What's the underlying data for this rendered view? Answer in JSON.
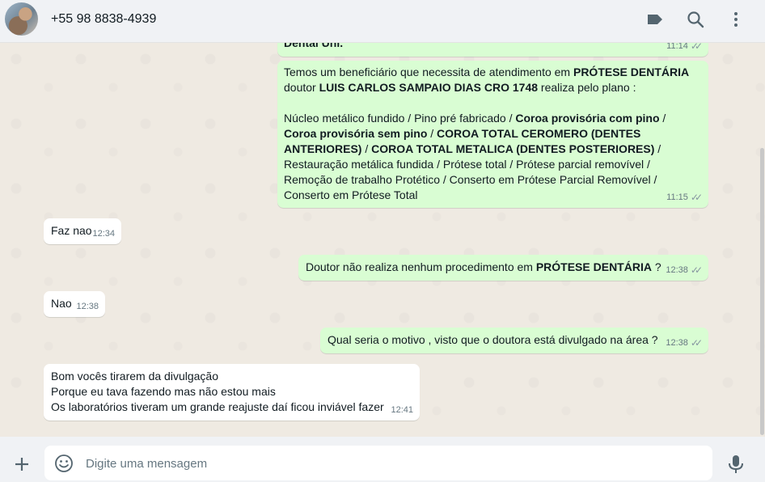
{
  "header": {
    "contact_name": "+55 98 8838-4939"
  },
  "icons": {
    "avatar": "avatar",
    "labels": "label-icon",
    "search": "search-icon",
    "menu": "more-vertical-icon",
    "attach": "plus-icon",
    "emoji": "emoji-icon",
    "mic": "mic-icon"
  },
  "colors": {
    "outgoing_bubble": "#d9fdd3",
    "incoming_bubble": "#ffffff",
    "chat_background": "#efeae2",
    "header_background": "#f0f2f5"
  },
  "messages": [
    {
      "id": "m0",
      "direction": "out",
      "text_bold": "Dental Uni.",
      "time": "11:14",
      "status": "read"
    },
    {
      "id": "m1",
      "direction": "out",
      "time": "11:15",
      "status": "read",
      "p1": "Temos um beneficiário que necessita de atendimento em ",
      "p1_b": "PRÓTESE DENTÁRIA",
      "p2": "doutor ",
      "p2_b": "LUIS CARLOS SAMPAIO DIAS  CRO 1748",
      "p2_tail": "  realiza pelo plano :",
      "l1": " Núcleo metálico fundido  /  Pino pré fabricado / ",
      "l1_b": "Coroa provisória com pino",
      "l1_tail": "  /",
      "l2_b": "Coroa provisória sem pino",
      "l2_mid": "  /  ",
      "l2_b2": "COROA TOTAL CEROMERO (DENTES",
      "l3_b": "ANTERIORES)",
      "l3_mid": " / ",
      "l3_b2": "COROA TOTAL METALICA (DENTES POSTERIORES)",
      "l3_tail": " /",
      "l4": "Restauração metálica fundida  /  Prótese total  /  Prótese parcial removível   /",
      "l5": "Remoção de trabalho Protético   /  Conserto em Prótese Parcial Removível  /",
      "l6": "Conserto em Prótese Total"
    },
    {
      "id": "m2",
      "direction": "in",
      "text": "Faz nao",
      "time": "12:34"
    },
    {
      "id": "m3",
      "direction": "out",
      "text": "Doutor não realiza nenhum procedimento em ",
      "text_b": "PRÓTESE DENTÁRIA",
      "text_tail": "  ?",
      "time": "12:38",
      "status": "read"
    },
    {
      "id": "m4",
      "direction": "in",
      "text": "Nao",
      "time": "12:38"
    },
    {
      "id": "m5",
      "direction": "out",
      "text": "Qual seria o motivo , visto que o doutora está divulgado na área ?",
      "time": "12:38",
      "status": "read"
    },
    {
      "id": "m6",
      "direction": "in",
      "time": "12:41",
      "lines": [
        "Bom vocês  tirarem da divulgação",
        "Porque eu tava fazendo mas não estou mais",
        "Os laboratórios tiveram um grande reajuste daí ficou inviável fazer"
      ]
    }
  ],
  "composer": {
    "placeholder": "Digite uma mensagem"
  }
}
